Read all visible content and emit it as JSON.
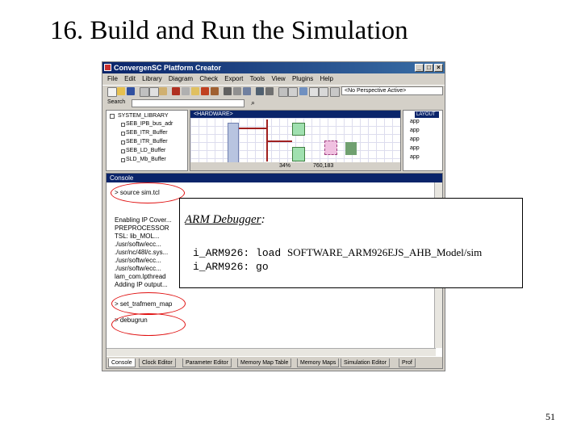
{
  "slide": {
    "title": "16. Build and Run the Simulation",
    "page_number": "51"
  },
  "window": {
    "title": "ConvergenSC Platform Creator",
    "menu": [
      "File",
      "Edit",
      "Library",
      "Diagram",
      "Check",
      "Export",
      "Tools",
      "View",
      "Plugins",
      "Help"
    ],
    "perspective": "<No Perspective Active>",
    "search_label": "Search"
  },
  "library": {
    "title": "SYSTEM_LIBRARY",
    "items": [
      "SEB_IPB_bus_adr",
      "SEB_ITR_Buffer",
      "SEB_ITR_Buffer",
      "SEB_LD_Buffer",
      "SLD_Mb_Buffer"
    ]
  },
  "hardware": {
    "header": "<HARDWARE>",
    "zoom": "34%",
    "coords": "760,183"
  },
  "right_panel": {
    "header": "LAYOUT",
    "items": [
      "app",
      "app",
      "app",
      "app",
      "app"
    ]
  },
  "console": {
    "header": "Console",
    "lines": [
      "> source sim.tcl",
      "Enabling IP Cover...",
      "PREPROCESSOR",
      "TSL: lib_MOL...",
      "./usr/softw/ecc...",
      "./usr/nc/48l/c.sys...",
      "./usr/softw/ecc...",
      "./usr/softw/ecc...",
      "lam_com.lpthread",
      "Adding IP output...",
      "> set_trafmem_map",
      "> debugrun"
    ],
    "tabs": [
      "Console",
      "Clock Editor",
      "Parameter Editor",
      "Memory Map Table",
      "Memory Maps",
      "Simulation Editor",
      "Prof"
    ]
  },
  "debugger": {
    "title": "ARM Debugger",
    "title_suffix": ":",
    "lines": [
      {
        "prefix": "i_ARM926: load ",
        "arg": "SOFTWARE_ARM926EJS_AHB_Model/sim"
      },
      {
        "prefix": "i_ARM926: go",
        "arg": ""
      }
    ]
  }
}
